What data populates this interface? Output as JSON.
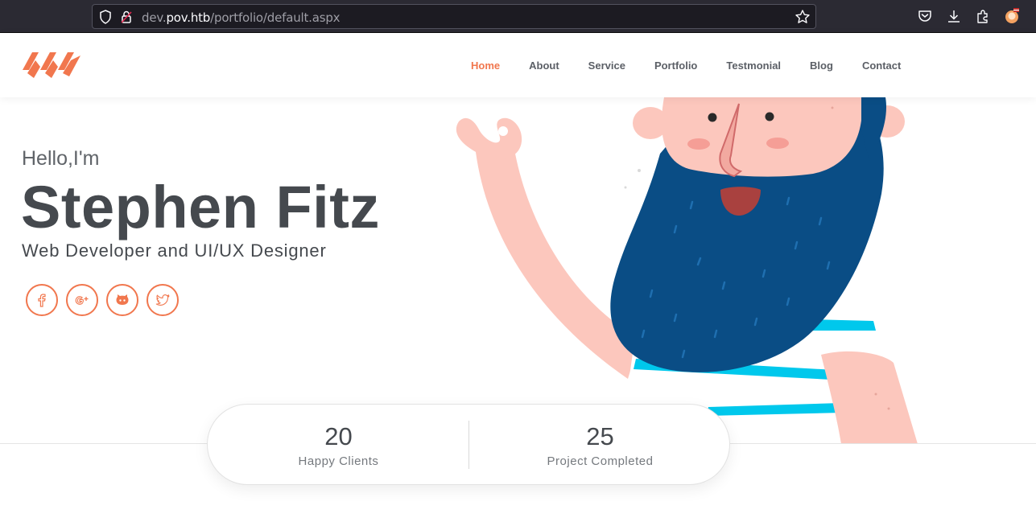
{
  "browser": {
    "url_prefix": "dev.",
    "url_host": "pov.htb",
    "url_path": "/portfolio/default.aspx"
  },
  "nav": {
    "items": [
      {
        "label": "Home",
        "active": true
      },
      {
        "label": "About"
      },
      {
        "label": "Service"
      },
      {
        "label": "Portfolio"
      },
      {
        "label": "Testmonial"
      },
      {
        "label": "Blog"
      },
      {
        "label": "Contact"
      }
    ]
  },
  "hero": {
    "greeting": "Hello,I'm",
    "name": "Stephen Fitz",
    "role": "Web Developer and UI/UX Designer",
    "socials": [
      "facebook-icon",
      "google-plus-icon",
      "github-icon",
      "twitter-icon"
    ]
  },
  "stats": [
    {
      "value": "20",
      "label": "Happy Clients"
    },
    {
      "value": "25",
      "label": "Project Completed"
    }
  ],
  "colors": {
    "accent": "#f1774e",
    "text_dark": "#45494e",
    "beard": "#0a4d85",
    "skin": "#fcc7bd",
    "stripe": "#00c8ec"
  }
}
